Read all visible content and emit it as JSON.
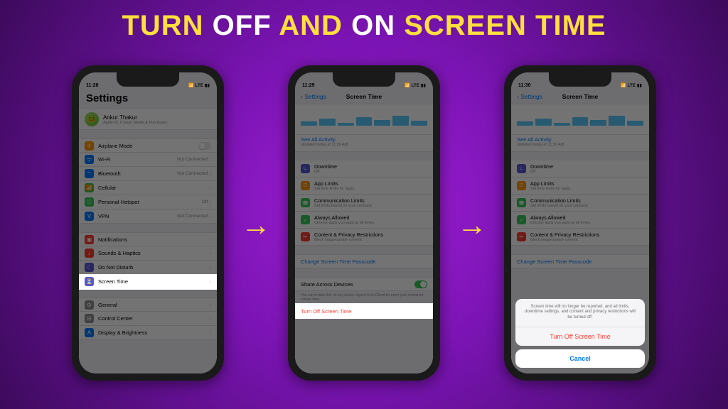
{
  "title": {
    "p1": "TURN",
    "p2": "OFF",
    "p3": "AND",
    "p4": "ON",
    "p5": "SCREEN TIME"
  },
  "arrows": {
    "glyph": "→"
  },
  "phone1": {
    "time": "11:28",
    "sb_right": "📶 LTE ▮▮",
    "header": "Settings",
    "profile_name": "Ankur Thakur",
    "profile_sub": "Apple ID, iCloud, Media & Purchases",
    "rows_a": [
      {
        "label": "Airplane Mode",
        "value": "",
        "iconColor": "c-or",
        "glyph": "✈"
      },
      {
        "label": "Wi-Fi",
        "value": "Not Connected",
        "iconColor": "c-bl",
        "glyph": "ᯤ"
      },
      {
        "label": "Bluetooth",
        "value": "Not Connected",
        "iconColor": "c-bl",
        "glyph": "⌔"
      },
      {
        "label": "Cellular",
        "value": "",
        "iconColor": "c-gn",
        "glyph": "📶"
      },
      {
        "label": "Personal Hotspot",
        "value": "Off",
        "iconColor": "c-gn",
        "glyph": "⎋"
      },
      {
        "label": "VPN",
        "value": "Not Connected",
        "iconColor": "c-bl",
        "glyph": "V"
      }
    ],
    "rows_b": [
      {
        "label": "Notifications",
        "iconColor": "c-rd",
        "glyph": "▣"
      },
      {
        "label": "Sounds & Haptics",
        "iconColor": "c-rd",
        "glyph": "♪"
      },
      {
        "label": "Do Not Disturb",
        "iconColor": "c-pu",
        "glyph": "☾"
      },
      {
        "label": "Screen Time",
        "iconColor": "c-pu",
        "glyph": "⏳"
      }
    ],
    "rows_c": [
      {
        "label": "General",
        "iconColor": "c-gy",
        "glyph": "⚙"
      },
      {
        "label": "Control Center",
        "iconColor": "c-gy",
        "glyph": "⊟"
      },
      {
        "label": "Display & Brightness",
        "iconColor": "c-bl",
        "glyph": "A"
      }
    ]
  },
  "phone2": {
    "time": "11:29",
    "back": "‹ Settings",
    "title": "Screen Time",
    "seeall": "See All Activity",
    "updated": "Updated today at 11:29 AM",
    "opts": [
      {
        "t": "Downtime",
        "s": "Off",
        "c": "c-pu",
        "g": "⏾"
      },
      {
        "t": "App Limits",
        "s": "Set time limits for apps.",
        "c": "c-or",
        "g": "⏱"
      },
      {
        "t": "Communication Limits",
        "s": "Set limits based on your contacts.",
        "c": "c-gn",
        "g": "☎"
      },
      {
        "t": "Always Allowed",
        "s": "Choose apps you want at all times.",
        "c": "c-gn",
        "g": "✓"
      },
      {
        "t": "Content & Privacy Restrictions",
        "s": "Block inappropriate content.",
        "c": "c-rd",
        "g": "⛔"
      }
    ],
    "passcode": "Change Screen Time Passcode",
    "share_label": "Share Across Devices",
    "share_note": "You can enable this on any device signed in to iCloud to report your combined screen time.",
    "turnoff": "Turn Off Screen Time"
  },
  "phone3": {
    "time": "11:30",
    "back": "‹ Settings",
    "title": "Screen Time",
    "seeall": "See All Activity",
    "updated": "Updated today at 11:30 AM",
    "opts": [
      {
        "t": "Downtime",
        "s": "Off",
        "c": "c-pu",
        "g": "⏾"
      },
      {
        "t": "App Limits",
        "s": "Set time limits for apps.",
        "c": "c-or",
        "g": "⏱"
      },
      {
        "t": "Communication Limits",
        "s": "Set limits based on your contacts.",
        "c": "c-gn",
        "g": "☎"
      },
      {
        "t": "Always Allowed",
        "s": "Choose apps you want at all times.",
        "c": "c-gn",
        "g": "✓"
      },
      {
        "t": "Content & Privacy Restrictions",
        "s": "Block inappropriate content.",
        "c": "c-rd",
        "g": "⛔"
      }
    ],
    "passcode": "Change Screen Time Passcode",
    "sheet_msg": "Screen time will no longer be reported, and all limits, downtime settings, and content and privacy restrictions will be turned off.",
    "sheet_action": "Turn Off Screen Time",
    "sheet_cancel": "Cancel"
  }
}
